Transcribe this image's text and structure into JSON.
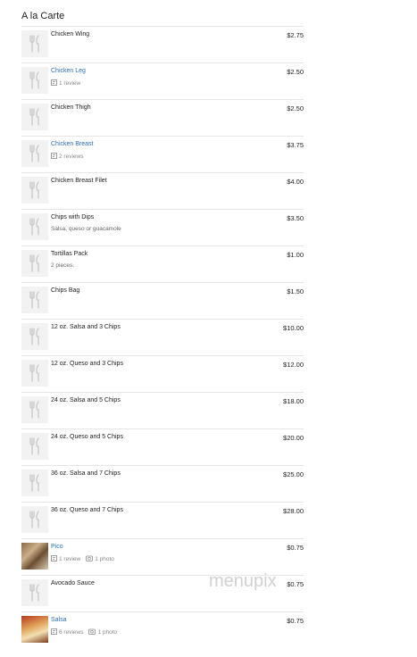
{
  "section": {
    "title": "A la Carte"
  },
  "watermark": {
    "text": "menupix"
  },
  "items": [
    {
      "name": "Chicken Wing",
      "price": "$2.75",
      "link": false,
      "desc": "",
      "reviews": "",
      "photos": "",
      "thumb": "placeholder"
    },
    {
      "name": "Chicken Leg",
      "price": "$2.50",
      "link": true,
      "desc": "",
      "reviews": "1 review",
      "photos": "",
      "thumb": "placeholder"
    },
    {
      "name": "Chicken Thigh",
      "price": "$2.50",
      "link": false,
      "desc": "",
      "reviews": "",
      "photos": "",
      "thumb": "placeholder"
    },
    {
      "name": "Chicken Breast",
      "price": "$3.75",
      "link": true,
      "desc": "",
      "reviews": "2 reviews",
      "photos": "",
      "thumb": "placeholder"
    },
    {
      "name": "Chicken Breast Filet",
      "price": "$4.00",
      "link": false,
      "desc": "",
      "reviews": "",
      "photos": "",
      "thumb": "placeholder"
    },
    {
      "name": "Chips with Dips",
      "price": "$3.50",
      "link": false,
      "desc": "Salsa, queso or guacamole",
      "reviews": "",
      "photos": "",
      "thumb": "placeholder"
    },
    {
      "name": "Tortillas Pack",
      "price": "$1.00",
      "link": false,
      "desc": "2 pieces.",
      "reviews": "",
      "photos": "",
      "thumb": "placeholder"
    },
    {
      "name": "Chips Bag",
      "price": "$1.50",
      "link": false,
      "desc": "",
      "reviews": "",
      "photos": "",
      "thumb": "placeholder"
    },
    {
      "name": "12 oz. Salsa and 3 Chips",
      "price": "$10.00",
      "link": false,
      "desc": "",
      "reviews": "",
      "photos": "",
      "thumb": "placeholder"
    },
    {
      "name": "12 oz. Queso and 3 Chips",
      "price": "$12.00",
      "link": false,
      "desc": "",
      "reviews": "",
      "photos": "",
      "thumb": "placeholder"
    },
    {
      "name": "24 oz. Salsa and 5 Chips",
      "price": "$18.00",
      "link": false,
      "desc": "",
      "reviews": "",
      "photos": "",
      "thumb": "placeholder"
    },
    {
      "name": "24 oz. Queso and 5 Chips",
      "price": "$20.00",
      "link": false,
      "desc": "",
      "reviews": "",
      "photos": "",
      "thumb": "placeholder"
    },
    {
      "name": "36 oz. Salsa and 7 Chips",
      "price": "$25.00",
      "link": false,
      "desc": "",
      "reviews": "",
      "photos": "",
      "thumb": "placeholder"
    },
    {
      "name": "36 oz. Queso and 7 Chips",
      "price": "$28.00",
      "link": false,
      "desc": "",
      "reviews": "",
      "photos": "",
      "thumb": "placeholder"
    },
    {
      "name": "Pico",
      "price": "$0.75",
      "link": true,
      "desc": "",
      "reviews": "1 review",
      "photos": "1 photo",
      "thumb": "photo-pico"
    },
    {
      "name": "Avocado Sauce",
      "price": "$0.75",
      "link": false,
      "desc": "",
      "reviews": "",
      "photos": "",
      "thumb": "placeholder"
    },
    {
      "name": "Salsa",
      "price": "$0.75",
      "link": true,
      "desc": "",
      "reviews": "6 reviews",
      "photos": "1 photo",
      "thumb": "photo-salsa"
    }
  ]
}
